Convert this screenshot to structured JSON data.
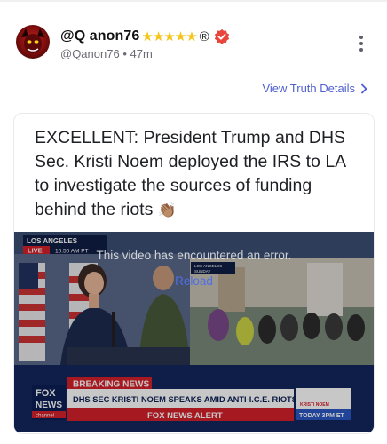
{
  "post": {
    "display_name": "@Q anon76",
    "stars": "★★★★★",
    "registered_mark": "®",
    "handle": "@Qanon76",
    "separator": "•",
    "time_ago": "47m",
    "view_details": "View Truth Details",
    "text": "EXCELLENT: President Trump and DHS Sec. Kristi Noem deployed the IRS to LA to investigate the sources of funding behind the riots",
    "emoji": "👏🏽"
  },
  "video": {
    "error_message": "This video has encountered an error.",
    "reload_label": "Reload",
    "tv": {
      "location": "LOS ANGELES",
      "live": "LIVE",
      "time": "10:50 AM PT",
      "inset_location": "LOS ANGELES",
      "inset_day": "SUNDAY",
      "breaking": "BREAKING NEWS",
      "headline": "DHS SEC KRISTI NOEM SPEAKS AMID ANTI-I.C.E. RIOTS",
      "fox": "FOX",
      "news": "NEWS",
      "channel": "channel",
      "alert": "FOX NEWS ALERT",
      "promo": "KRISTI NOEM",
      "promo_time": "TODAY 3PM ET"
    }
  },
  "colors": {
    "accent": "#4f5fd1",
    "verified": "#e8453c",
    "stars": "#f5c518"
  }
}
